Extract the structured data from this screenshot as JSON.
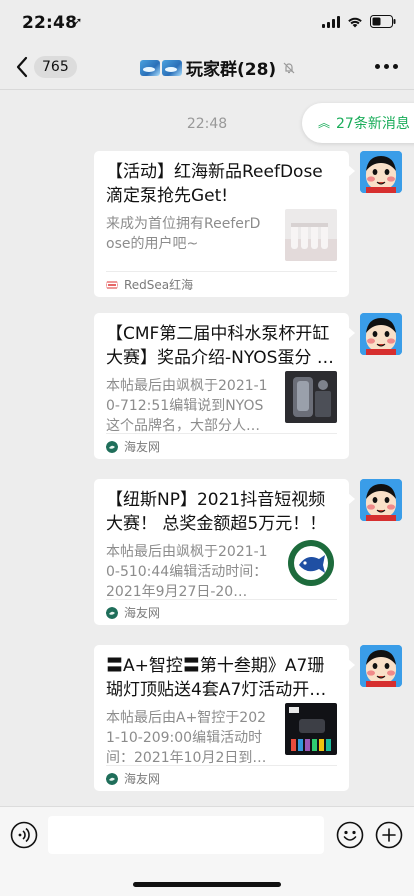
{
  "status_bar": {
    "time": "22:48",
    "location_arrow": "➚",
    "icons": [
      "signal-icon",
      "wifi-icon",
      "battery-icon"
    ]
  },
  "nav": {
    "back_count": "765",
    "title": "玩家群(28)",
    "icons": [
      "back-icon",
      "mute-icon",
      "more-icon"
    ]
  },
  "chat": {
    "timestamp": "22:48",
    "new_messages": "27条新消息",
    "messages": [
      {
        "title": "【活动】红海新品ReefDose滴定泵抢先Get!",
        "desc": "来成为首位拥有ReeferDose的用户吧~",
        "source": "RedSea红海"
      },
      {
        "title": "【CMF第二届中科水泵杯开缸大赛】奖品介绍-NYOS蛋分 …",
        "desc": "本帖最后由飒枫于2021-10-712:51编辑说到NYOS这个品牌名，大部分人…",
        "source": "海友网"
      },
      {
        "title": "【纽斯NP】2021抖音短视频大赛！ 总奖金额超5万元！！",
        "desc": "本帖最后由飒枫于2021-10-510:44编辑活动时间：2021年9月27日-20…",
        "source": "海友网"
      },
      {
        "title": "〓A+智控〓第十叁期》A7珊瑚灯顶贴送4套A7灯活动开…",
        "desc": "本帖最后由A+智控于2021-10-209:00编辑活动时间：2021年10月2日到1…",
        "source": "海友网"
      }
    ]
  },
  "input_bar": {
    "icons": [
      "voice-icon",
      "emoji-icon",
      "plus-icon"
    ]
  },
  "colors": {
    "background": "#ededed",
    "accent_green": "#1aad5a",
    "bubble": "#ffffff",
    "secondary_text": "#8c8c8c"
  }
}
